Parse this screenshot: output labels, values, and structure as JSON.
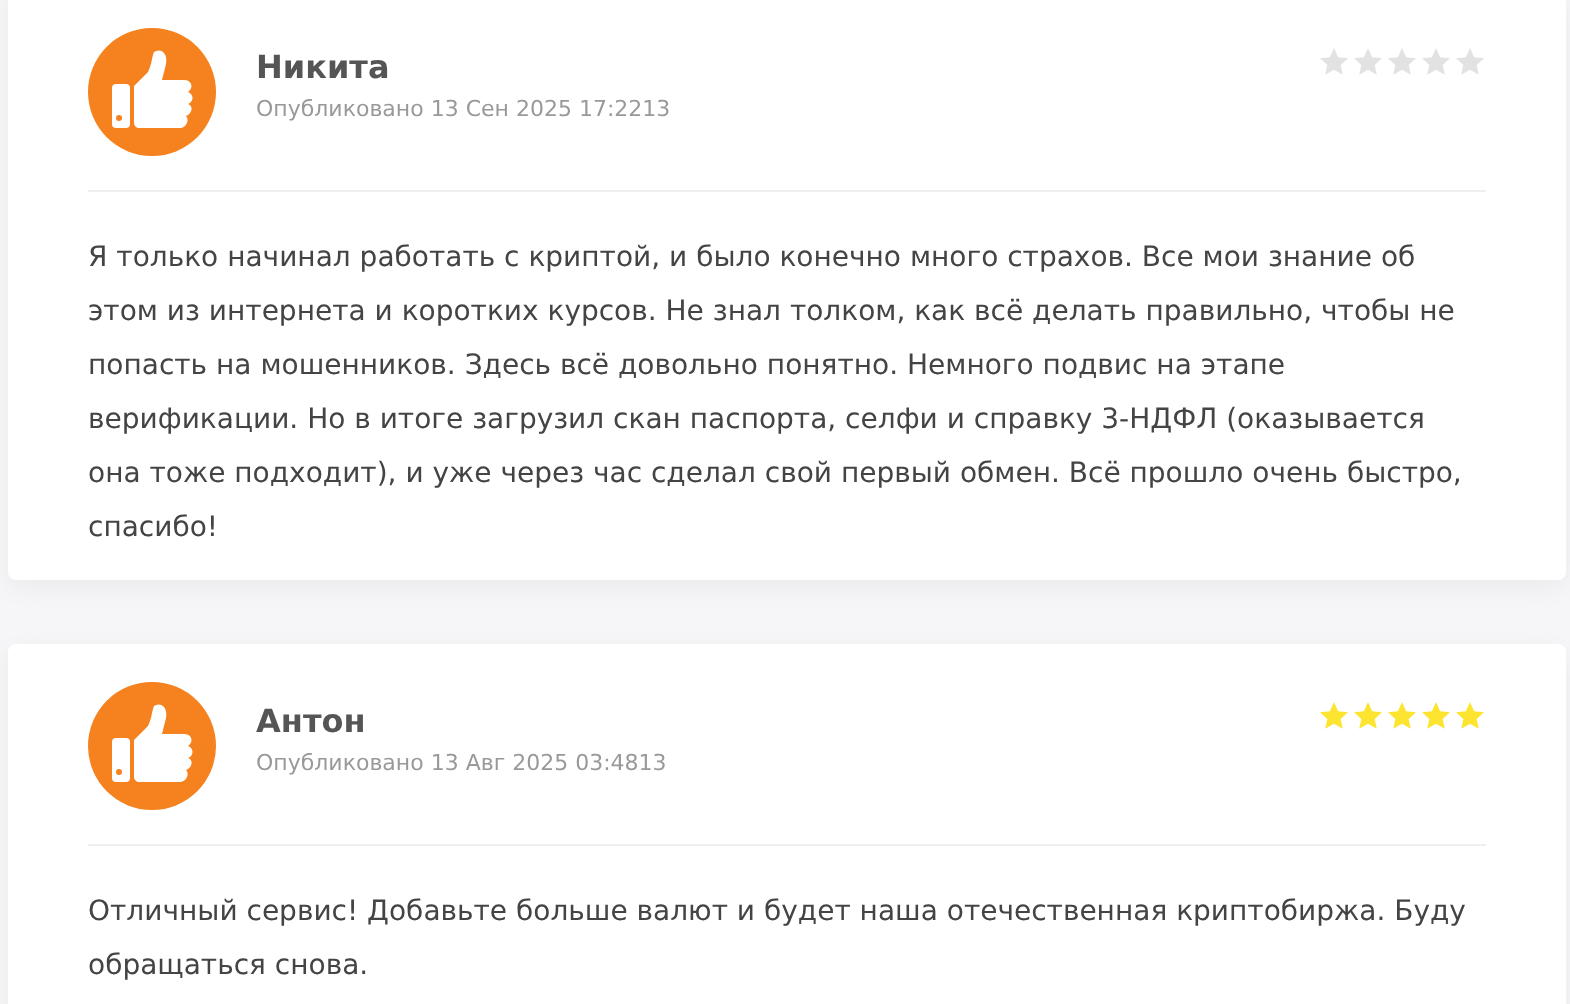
{
  "reviews": [
    {
      "author": "Никита",
      "date": "Опубликовано 13 Сен 2025 17:2213",
      "stars": 0,
      "text": "Я только начинал работать с криптой, и было конечно много страхов. Все мои знание об этом из интернета и коротких курсов. Не знал толком, как всё делать правильно, чтобы не попасть на мошенников. Здесь всё довольно понятно. Немного подвис на этапе верификации. Но в итоге загрузил скан паспорта, селфи и справку 3-НДФЛ (оказывается она тоже подходит), и уже через час сделал свой первый обмен. Всё прошло очень быстро, спасибо!"
    },
    {
      "author": "Антон",
      "date": "Опубликовано 13 Авг 2025 03:4813",
      "stars": 5,
      "text": "Отличный сервис! Добавьте больше валют и будет наша отечественная криптобиржа. Буду обращаться снова."
    }
  ]
}
